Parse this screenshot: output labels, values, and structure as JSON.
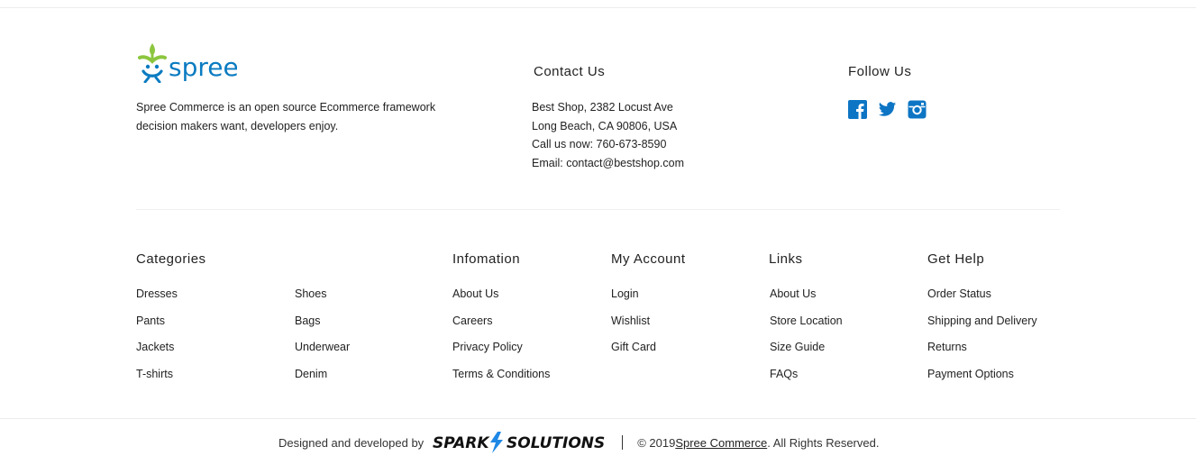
{
  "brand": {
    "logo_text": "spree",
    "description": "Spree Commerce is an open source Ecommerce framework decision makers want, developers enjoy."
  },
  "contact": {
    "heading": "Contact Us",
    "address_line1": "Best Shop, 2382 Locust Ave",
    "address_line2": "Long Beach, CA 90806, USA",
    "phone": "Call us now: 760-673-8590",
    "email": "Email: contact@bestshop.com"
  },
  "follow": {
    "heading": "Follow Us",
    "icons": [
      "facebook-icon",
      "twitter-icon",
      "instagram-icon"
    ]
  },
  "columns": {
    "categories": {
      "heading": "Categories",
      "col1": [
        "Dresses",
        "Pants",
        "Jackets",
        "T-shirts"
      ],
      "col2": [
        "Shoes",
        "Bags",
        "Underwear",
        "Denim"
      ]
    },
    "information": {
      "heading": "Infomation",
      "items": [
        "About Us",
        "Careers",
        "Privacy Policy",
        "Terms & Conditions"
      ]
    },
    "account": {
      "heading": "My Account",
      "items": [
        "Login",
        "Wishlist",
        "Gift Card"
      ]
    },
    "links": {
      "heading": "Links",
      "items": [
        "About Us",
        "Store Location",
        "Size Guide",
        "FAQs"
      ]
    },
    "help": {
      "heading": "Get Help",
      "items": [
        "Order Status",
        "Shipping and Delivery",
        "Returns",
        "Payment Options"
      ]
    }
  },
  "bottom": {
    "designed_by": "Designed and developed by",
    "spark_logo_text": "SPARK SOLUTIONS",
    "copyright_prefix": "© 2019 ",
    "copyright_link": "Spree Commerce",
    "copyright_suffix": ". All Rights Reserved."
  },
  "colors": {
    "social_blue": "#0D75C4",
    "logo_green": "#8CC63F",
    "logo_blue": "#0A7BC1"
  }
}
